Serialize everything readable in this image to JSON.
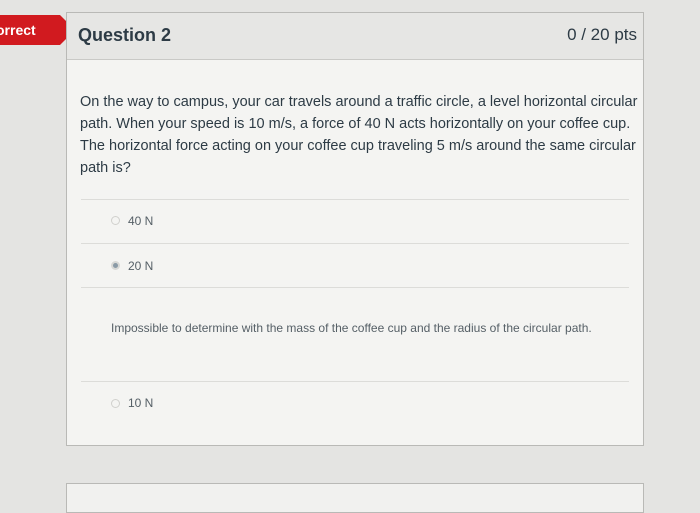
{
  "status_flag": "orrect",
  "question": {
    "title": "Question 2",
    "points": "0 / 20 pts",
    "text": "On the way to campus, your car travels around a traffic circle, a level horizontal circular path. When your speed is 10 m/s, a force of 40 N acts horizontally on your coffee cup. The horizontal force acting on your coffee cup traveling 5 m/s around the same circular path is?"
  },
  "answers": [
    {
      "label": "40 N",
      "selected": false
    },
    {
      "label": "20 N",
      "selected": true
    },
    {
      "label": "Impossible to determine with the mass of the coffee cup and the radius of the circular path.",
      "selected": false
    },
    {
      "label": "10 N",
      "selected": false
    }
  ]
}
